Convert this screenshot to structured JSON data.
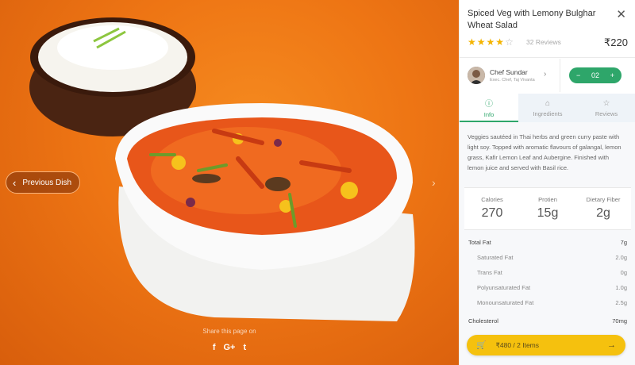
{
  "hero": {
    "prev_label": "Previous Dish",
    "share_label": "Share this page on",
    "share": [
      "f",
      "G+",
      "t"
    ]
  },
  "dish": {
    "title": "Spiced Veg with Lemony Bulghar Wheat Salad",
    "rating": 4,
    "rating_max": 5,
    "reviews": "32 Reviews",
    "price": "₹220"
  },
  "chef": {
    "name": "Chef Sundar",
    "title": "Exec. Chef, Taj Vivanta"
  },
  "quantity": {
    "value": "02",
    "minus": "−",
    "plus": "+"
  },
  "tabs": [
    {
      "label": "Info",
      "icon": "info-icon",
      "glyph": "ⓘ"
    },
    {
      "label": "Ingredients",
      "icon": "ingredients-icon",
      "glyph": "⌂"
    },
    {
      "label": "Reviews",
      "icon": "star-icon",
      "glyph": "☆"
    }
  ],
  "info": {
    "description": "Veggies sautéed in Thai herbs and green curry paste with light soy. Topped with aromatic flavours of galangal, lemon grass, Kafir Lemon Leaf and Aubergine. Finished with lemon juice and served with Basil rice.",
    "nutrition": [
      {
        "label": "Calories",
        "value": "270"
      },
      {
        "label": "Protien",
        "value": "15g"
      },
      {
        "label": "Dietary Fiber",
        "value": "2g"
      }
    ],
    "facts": [
      {
        "label": "Total Fat",
        "value": "7g",
        "level": "main"
      },
      {
        "label": "Saturated Fat",
        "value": "2.0g",
        "level": "sub"
      },
      {
        "label": "Trans Fat",
        "value": "0g",
        "level": "sub"
      },
      {
        "label": "Polyunsaturated Fat",
        "value": "1.0g",
        "level": "sub"
      },
      {
        "label": "Monounsaturated Fat",
        "value": "2.5g",
        "level": "sub"
      },
      {
        "label": "Cholesterol",
        "value": "70mg",
        "level": "main"
      }
    ]
  },
  "cart": {
    "label": "₹480 / 2 Items",
    "icon": "cart-icon"
  },
  "colors": {
    "accent_green": "#2ea66a",
    "cart_yellow": "#f5c10e",
    "hero_orange": "#ee7514"
  }
}
